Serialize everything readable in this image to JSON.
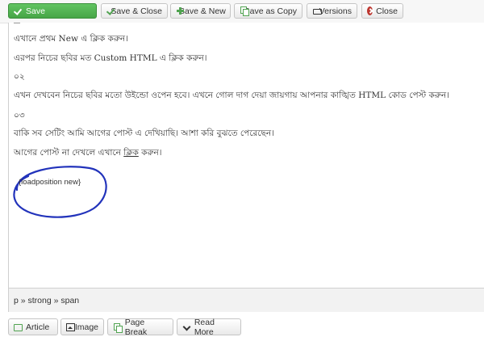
{
  "toolbar": {
    "save": "Save",
    "save_close": "Save & Close",
    "save_new": "Save & New",
    "save_copy": "Save as Copy",
    "versions": "Versions",
    "close": "Close"
  },
  "editor": {
    "lines": [
      "এখানে প্রথম New এ ক্লিক করুন।",
      "এরপর নিচের ছবির মত Custom HTML এ ক্লিক করুন।",
      "০২",
      "এখন দেখবেন নিচের ছবির মতো উইন্ডো ওপেন হবে। এখনে গোল দাগ দেয়া জায়গায় আপনার কাঙ্খিত HTML কোড পেস্ট করুন।",
      "০৩",
      "বাকি সব সেটিং আমি আগের পোস্ট এ দেখিয়াছি। আশা করি বুঝতে পেরেছেন।"
    ],
    "last_line_before": "আগের পোস্ট না দেখলে এখানে ",
    "last_line_link": "ক্লিক",
    "last_line_after": " করুন।",
    "load_position": "{loadposition new}",
    "annotation_color": "#2233bb"
  },
  "status": {
    "path": "p » strong » span"
  },
  "bottom_buttons": {
    "article": "Article",
    "image": "Image",
    "page_break": "Page Break",
    "read_more": "Read More"
  }
}
